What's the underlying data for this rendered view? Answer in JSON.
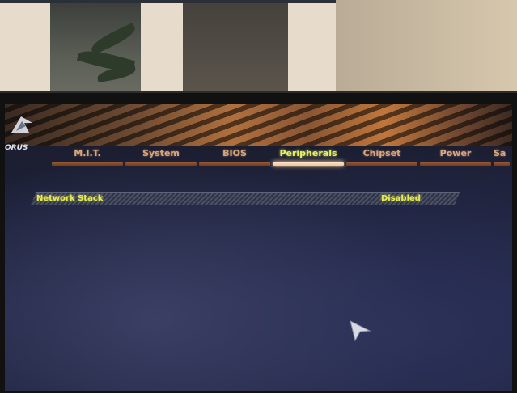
{
  "tabs": [
    {
      "label": "M.I.T."
    },
    {
      "label": "System"
    },
    {
      "label": "BIOS"
    },
    {
      "label": "Peripherals"
    },
    {
      "label": "Chipset"
    },
    {
      "label": "Power"
    },
    {
      "label": "Sa"
    }
  ],
  "active_tab": "Peripherals",
  "logo": {
    "text": "ORUS"
  },
  "setting": {
    "name": "Network Stack",
    "value": "Disabled"
  },
  "colors": {
    "tab_label": "#d6a77f",
    "active_tab_label": "#e7f066",
    "setting_text": "#e6ec4e",
    "screen_bg": "#1c2038"
  },
  "icons": {
    "logo": "aorus-eagle-icon",
    "cursor": "mouse-cursor-icon"
  }
}
